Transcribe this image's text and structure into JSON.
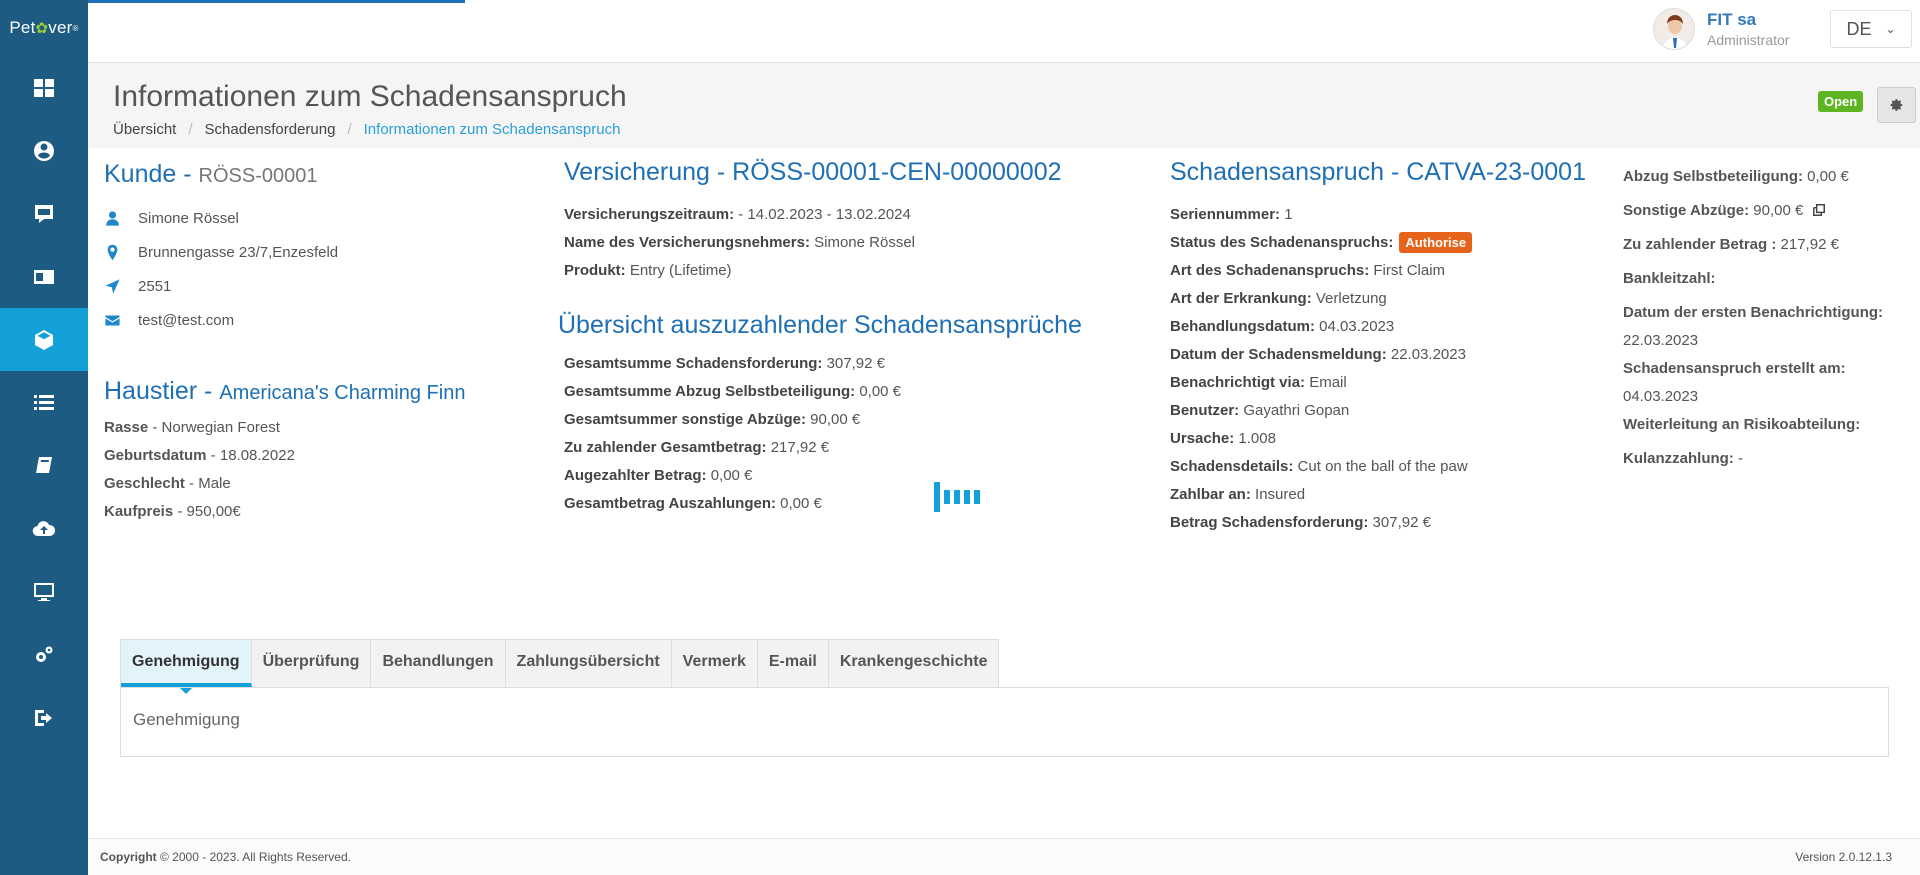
{
  "brand": {
    "name_pre": "Pet",
    "name_post": "ver",
    "logo_glyph": "✿",
    "tm": "®"
  },
  "sidebar": {
    "items": [
      {
        "icon": "dashboard-icon",
        "active": false
      },
      {
        "icon": "user-circle-icon",
        "active": false
      },
      {
        "icon": "chat-icon",
        "active": false
      },
      {
        "icon": "id-card-icon",
        "active": false
      },
      {
        "icon": "cube-icon",
        "active": true
      },
      {
        "icon": "list-icon",
        "active": false
      },
      {
        "icon": "book-icon",
        "active": false
      },
      {
        "icon": "cloud-upload-icon",
        "active": false
      },
      {
        "icon": "monitor-icon",
        "active": false
      },
      {
        "icon": "cogs-icon",
        "active": false
      },
      {
        "icon": "sign-out-icon",
        "active": false
      }
    ]
  },
  "topbar": {
    "user_name": "FIT sa",
    "user_role": "Administrator",
    "language": "DE"
  },
  "page": {
    "title": "Informationen zum Schadensanspruch",
    "breadcrumb": [
      "Übersicht",
      "Schadensforderung",
      "Informationen zum Schadensanspruch"
    ],
    "status": "Open"
  },
  "customer": {
    "heading": "Kunde - ",
    "id": "RÖSS-00001",
    "name": "Simone Rössel",
    "address": "Brunnengasse 23/7,Enzesfeld",
    "zip": "2551",
    "email": "test@test.com"
  },
  "pet": {
    "heading": "Haustier - ",
    "name": "Americana's Charming Finn",
    "rows": [
      {
        "label": "Rasse",
        "value": " - Norwegian Forest"
      },
      {
        "label": "Geburtsdatum",
        "value": " - 18.08.2022"
      },
      {
        "label": "Geschlecht",
        "value": " - Male"
      },
      {
        "label": "Kaufpreis",
        "value": " - 950,00€"
      }
    ]
  },
  "insurance": {
    "heading": "Versicherung - RÖSS-00001-CEN-00000002",
    "rows": [
      {
        "label": "Versicherungszeitraum:",
        "value": " - 14.02.2023 - 13.02.2024"
      },
      {
        "label": "Name des Versicherungsnehmers:",
        "value": " Simone Rössel"
      },
      {
        "label": "Produkt:",
        "value": " Entry (Lifetime)"
      }
    ]
  },
  "payout_overview": {
    "heading": "Übersicht auszuzahlender Schadensansprüche",
    "rows": [
      {
        "label": "Gesamtsumme Schadensforderung:",
        "value": " 307,92 €"
      },
      {
        "label": "Gesamtsumme Abzug Selbstbeteiligung:",
        "value": " 0,00 €"
      },
      {
        "label": "Gesamtsummer sonstige Abzüge:",
        "value": " 90,00 €"
      },
      {
        "label": "Zu zahlender Gesamtbetrag:",
        "value": " 217,92 €"
      },
      {
        "label": "Augezahlter Betrag:",
        "value": " 0,00 €"
      },
      {
        "label": "Gesamtbetrag Auszahlungen:",
        "value": " 0,00 €"
      }
    ]
  },
  "claim": {
    "heading": "Schadensanspruch - CATVA-23-0001",
    "serial_label": "Seriennummer:",
    "serial_value": " 1",
    "status_label": "Status des Schadenanspruchs:",
    "status_badge": "Authorise",
    "rows": [
      {
        "label": "Art des Schadenanspruchs:",
        "value": " First Claim"
      },
      {
        "label": "Art der Erkrankung:",
        "value": " Verletzung"
      },
      {
        "label": "Behandlungsdatum:",
        "value": " 04.03.2023"
      },
      {
        "label": "Datum der Schadensmeldung:",
        "value": " 22.03.2023"
      },
      {
        "label": "Benachrichtigt via:",
        "value": " Email"
      },
      {
        "label": "Benutzer:",
        "value": " Gayathri Gopan"
      },
      {
        "label": "Ursache:",
        "value": " 1.008"
      },
      {
        "label": "Schadensdetails:",
        "value": " Cut on the ball of the paw"
      },
      {
        "label": "Zahlbar an:",
        "value": " Insured"
      },
      {
        "label": "Betrag Schadensforderung:",
        "value": " 307,92 €"
      }
    ]
  },
  "claim_side": {
    "deductible_label": "Abzug Selbstbeteiligung:",
    "deductible_value": " 0,00 €",
    "other_label": "Sonstige Abzüge:",
    "other_value": " 90,00 €",
    "payable_label": "Zu zahlender Betrag :",
    "payable_value": " 217,92 €",
    "bank_label": "Bankleitzahl:",
    "first_notice_label": "Datum der ersten Benachrichtigung:",
    "first_notice_value": "22.03.2023",
    "created_label": "Schadensanspruch erstellt am:",
    "created_value": "04.03.2023",
    "risk_label": "Weiterleitung an Risikoabteilung:",
    "goodwill_label": "Kulanzzahlung:",
    "goodwill_value": " -"
  },
  "tabs": [
    {
      "label": "Genehmigung",
      "active": true
    },
    {
      "label": "Überprüfung",
      "active": false
    },
    {
      "label": "Behandlungen",
      "active": false
    },
    {
      "label": "Zahlungsübersicht",
      "active": false
    },
    {
      "label": "Vermerk",
      "active": false
    },
    {
      "label": "E-mail",
      "active": false
    },
    {
      "label": "Krankengeschichte",
      "active": false
    }
  ],
  "tab_panel": {
    "content": "Genehmigung"
  },
  "footer": {
    "copyright_bold": "Copyright",
    "copyright_rest": " © 2000 - 2023. All Rights Reserved.",
    "version": "Version 2.0.12.1.3"
  },
  "colors": {
    "sidebar": "#1e5b82",
    "active": "#14a0d8",
    "heading": "#1e6fb5",
    "open": "#5cb521",
    "authorise": "#e8631a"
  }
}
